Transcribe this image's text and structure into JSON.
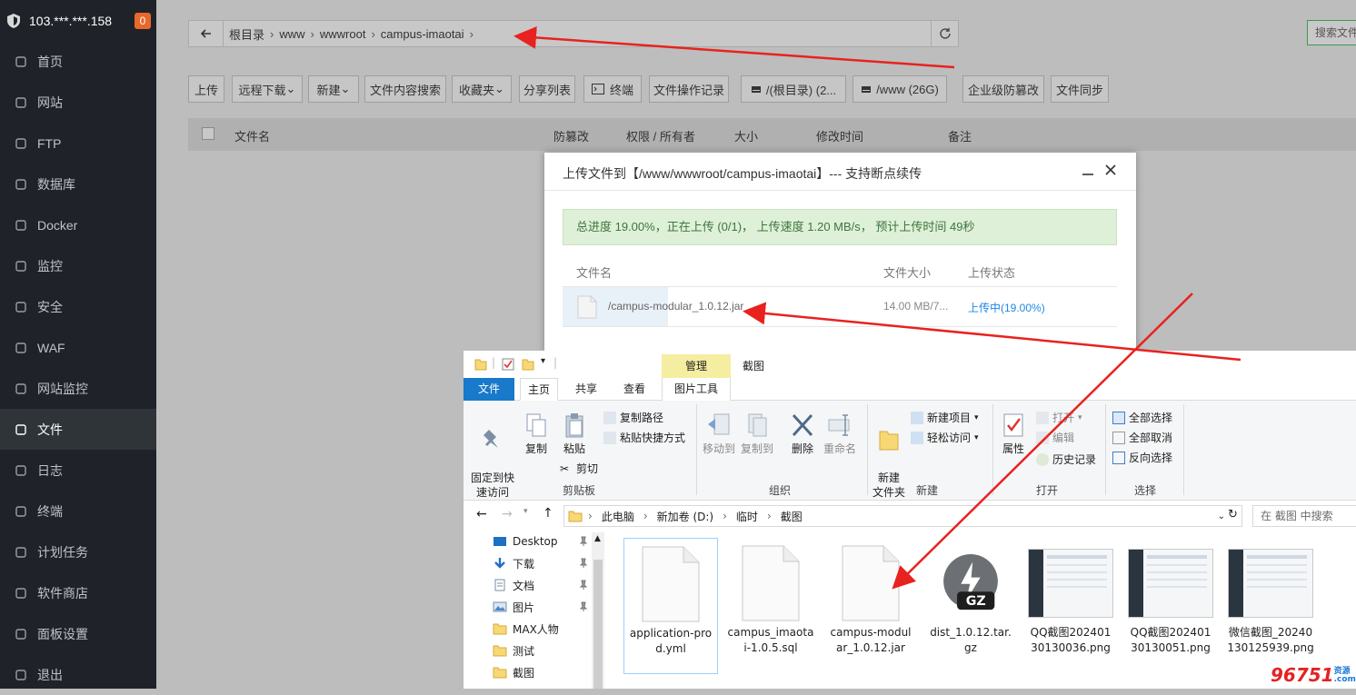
{
  "sidebar": {
    "server": "103.***.***.158",
    "badge": "0",
    "items": [
      {
        "label": "首页"
      },
      {
        "label": "网站"
      },
      {
        "label": "FTP"
      },
      {
        "label": "数据库"
      },
      {
        "label": "Docker"
      },
      {
        "label": "监控"
      },
      {
        "label": "安全"
      },
      {
        "label": "WAF"
      },
      {
        "label": "网站监控"
      },
      {
        "label": "文件",
        "active": true
      },
      {
        "label": "日志"
      },
      {
        "label": "终端"
      },
      {
        "label": "计划任务"
      },
      {
        "label": "软件商店"
      },
      {
        "label": "面板设置"
      },
      {
        "label": "退出"
      }
    ]
  },
  "pathbar": {
    "crumbs": [
      "根目录",
      "www",
      "wwwroot",
      "campus-imaotai"
    ],
    "search_label": "搜索文件"
  },
  "toolbar": {
    "upload": "上传",
    "remote_download": "远程下载",
    "new": "新建",
    "content_search": "文件内容搜索",
    "favorites": "收藏夹",
    "share_list": "分享列表",
    "terminal": "终端",
    "op_log": "文件操作记录",
    "disk_root": "/(根目录) (2...",
    "disk_www": "/www (26G)",
    "tamper": "企业级防篡改",
    "sync": "文件同步"
  },
  "file_header": {
    "name": "文件名",
    "tamper": "防篡改",
    "perm": "权限 / 所有者",
    "size": "大小",
    "mtime": "修改时间",
    "note": "备注"
  },
  "upload_dialog": {
    "title": "上传文件到【/www/wwwroot/campus-imaotai】--- 支持断点续传",
    "progress": "总进度 19.00%，正在上传 (0/1)， 上传速度 1.20 MB/s， 预计上传时间 49秒",
    "col_name": "文件名",
    "col_size": "文件大小",
    "col_status": "上传状态",
    "row": {
      "name": "/campus-modular_1.0.12.jar",
      "size": "14.00 MB/7...",
      "status": "上传中(19.00%)"
    }
  },
  "explorer": {
    "manage_tab": "管理",
    "title": "截图",
    "tabs": {
      "file": "文件",
      "home": "主页",
      "share": "共享",
      "view": "查看",
      "pic_tools": "图片工具"
    },
    "ribbon": {
      "pin": "固定到快\n速访问",
      "copy": "复制",
      "paste": "粘贴",
      "copy_path": "复制路径",
      "paste_shortcut": "粘贴快捷方式",
      "cut": "剪切",
      "clipboard": "剪贴板",
      "move_to": "移动到",
      "copy_to": "复制到",
      "delete": "删除",
      "rename": "重命名",
      "organize": "组织",
      "new_folder": "新建\n文件夹",
      "new_item": "新建项目",
      "easy_access": "轻松访问",
      "new_group": "新建",
      "properties": "属性",
      "open": "打开",
      "edit": "编辑",
      "history": "历史记录",
      "open_group": "打开",
      "select_all": "全部选择",
      "select_none": "全部取消",
      "invert": "反向选择",
      "select_group": "选择"
    },
    "address": [
      "此电脑",
      "新加卷 (D:)",
      "临时",
      "截图"
    ],
    "search_placeholder": "在 截图 中搜索",
    "nav": [
      "Desktop",
      "下载",
      "文档",
      "图片",
      "MAX人物",
      "测试",
      "截图"
    ],
    "files": [
      {
        "name": "application-prod.yml",
        "type": "doc"
      },
      {
        "name": "campus_imaotai-1.0.5.sql",
        "type": "doc"
      },
      {
        "name": "campus-modular_1.0.12.jar",
        "type": "doc"
      },
      {
        "name": "dist_1.0.12.tar.gz",
        "type": "gz"
      },
      {
        "name": "QQ截图20240130130036.png",
        "type": "img"
      },
      {
        "name": "QQ截图20240130130051.png",
        "type": "img"
      },
      {
        "name": "微信截图_20240130125939.png",
        "type": "img"
      }
    ]
  },
  "watermark": {
    "text": "96751",
    "sub": "资源\n.com"
  }
}
